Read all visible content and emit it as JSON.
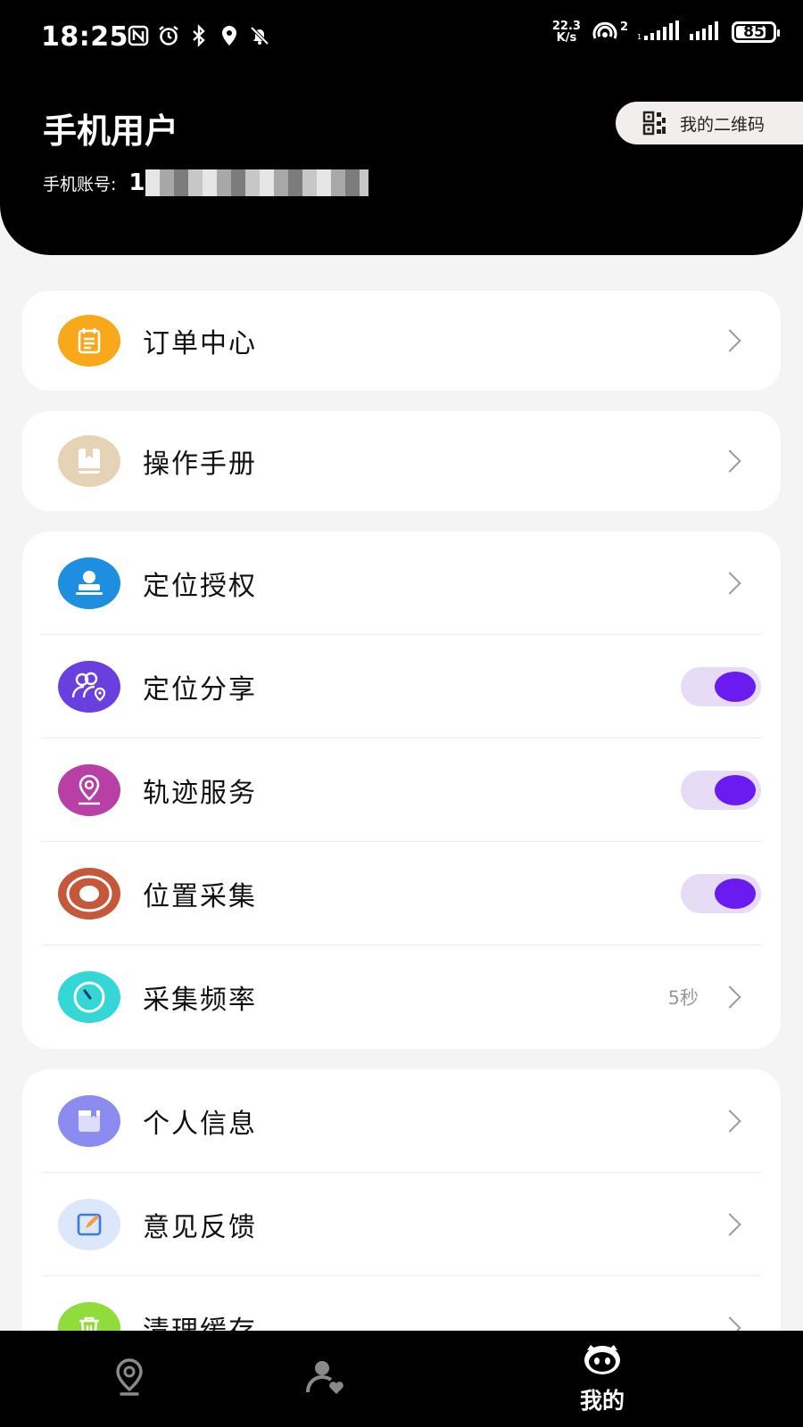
{
  "status_bar": {
    "time": "18:25",
    "net_speed_value": "22.3",
    "net_speed_unit": "K/s",
    "hotspot_count": "2",
    "battery": "85",
    "battery_level_percent": 85
  },
  "profile": {
    "name": "手机用户",
    "account_label": "手机账号:",
    "account_value_visible": "1",
    "qr_button_label": "我的二维码"
  },
  "menu": {
    "orders": {
      "label": "订单中心",
      "icon": "clipboard-icon",
      "color": "#f7a81b"
    },
    "manual": {
      "label": "操作手册",
      "icon": "book-icon",
      "color": "#e6d3b5"
    },
    "location_auth": {
      "label": "定位授权",
      "icon": "stamp-icon",
      "color": "#1e8fe0"
    },
    "location_share": {
      "label": "定位分享",
      "icon": "users-location-icon",
      "color": "#6a3fe0",
      "enabled": true
    },
    "track_service": {
      "label": "轨迹服务",
      "icon": "map-pin-icon",
      "color": "#b83fa5",
      "enabled": true
    },
    "location_collect": {
      "label": "位置采集",
      "icon": "target-icon",
      "color": "#c5583a",
      "enabled": true
    },
    "collect_frequency": {
      "label": "采集频率",
      "icon": "clock-icon",
      "color": "#35d6d6",
      "value": "5秒"
    },
    "personal_info": {
      "label": "个人信息",
      "icon": "profile-card-icon",
      "color": "#8c8cf0"
    },
    "feedback": {
      "label": "意见反馈",
      "icon": "edit-icon",
      "color": "#dce7fb"
    },
    "clear_cache": {
      "label": "清理缓存",
      "icon": "trash-icon",
      "color": "#8fdc3a"
    }
  },
  "bottom_nav": {
    "tab_map_icon": "location-pin-icon",
    "tab_contacts_icon": "user-heart-icon",
    "tab_me_icon": "mascot-face-icon",
    "tab_me_label": "我的"
  },
  "colors": {
    "accent": "#6a1cf0",
    "toggle_track": "#e6dcf6",
    "header_bg": "#000000",
    "page_bg": "#f4f4f4"
  }
}
